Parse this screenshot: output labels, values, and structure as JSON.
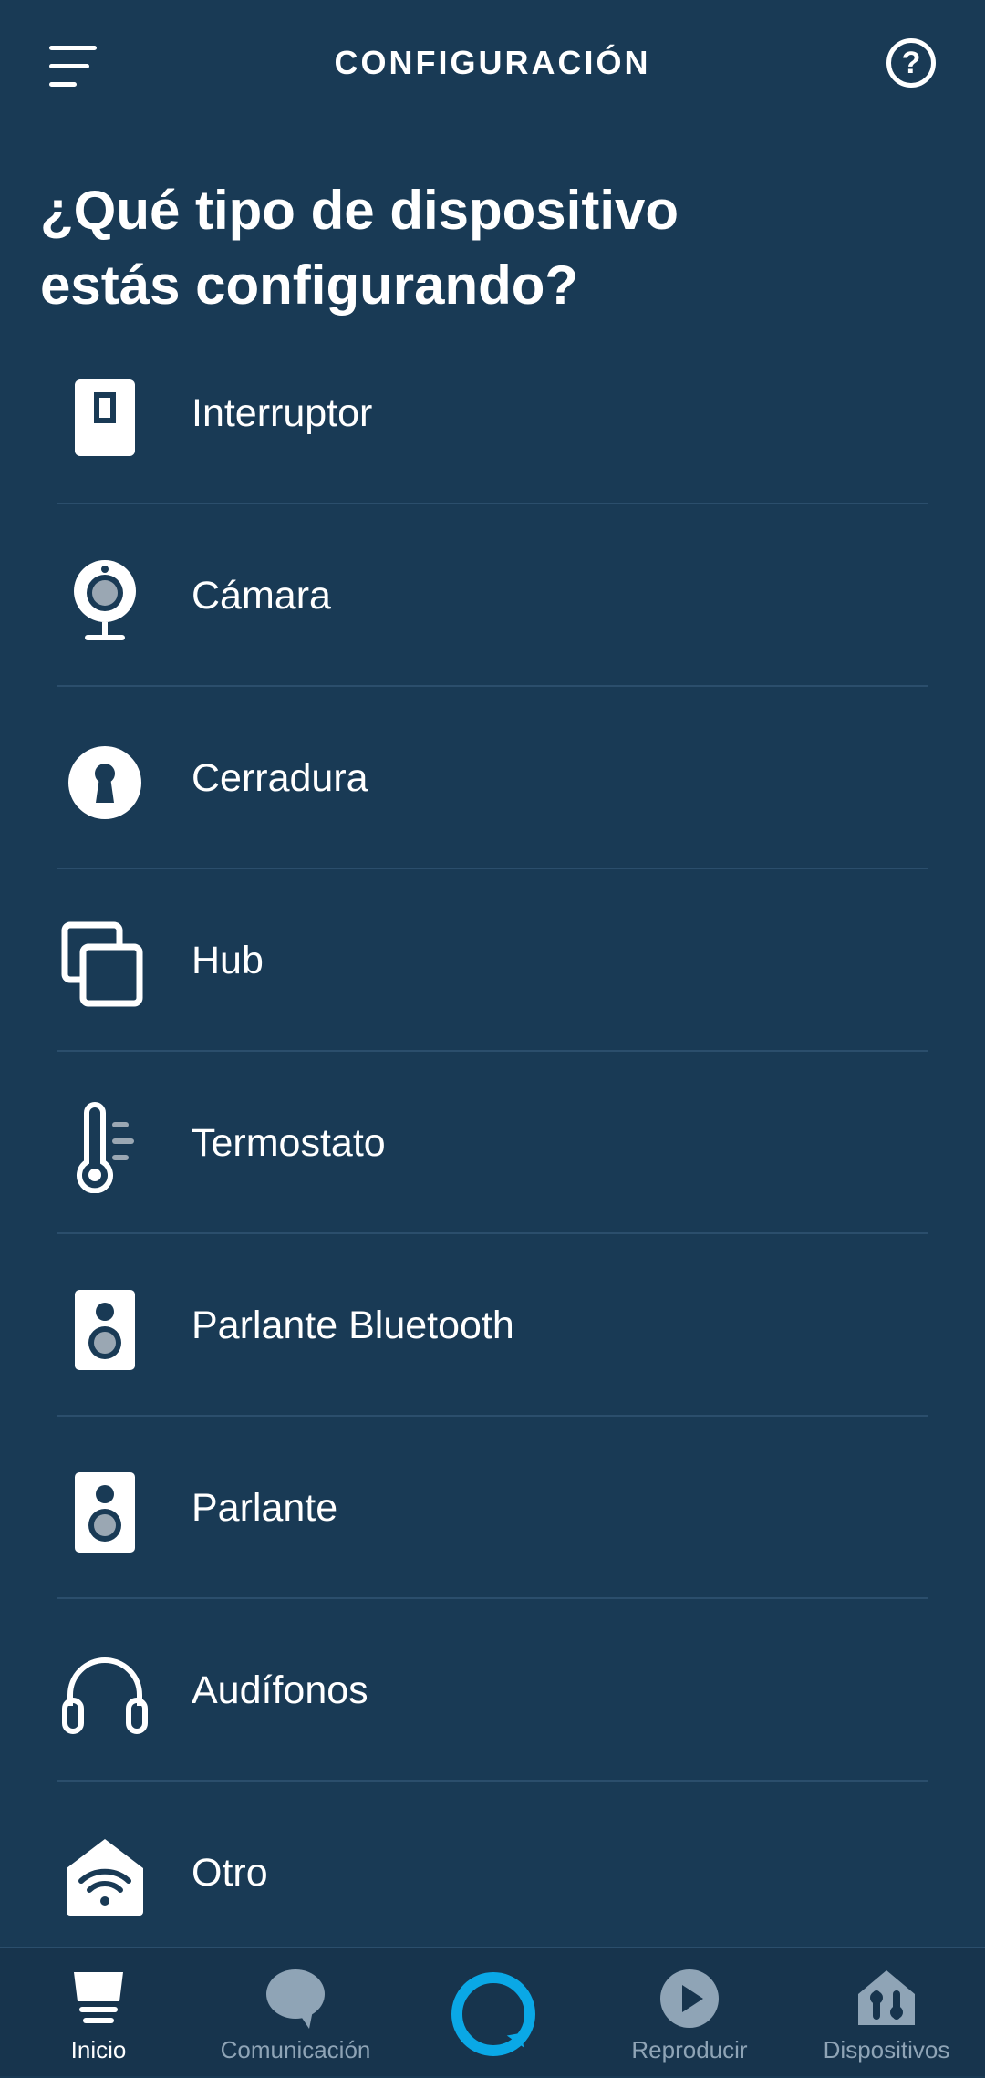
{
  "header": {
    "title": "CONFIGURACIÓN",
    "help_glyph": "?",
    "icons": {
      "menu": "hamburger-menu-icon",
      "help": "question-circle-icon"
    }
  },
  "headline": {
    "line1": "¿Qué tipo de dispositivo",
    "line2": "estás configurando?"
  },
  "device_types": [
    {
      "label": "Interruptor",
      "icon": "switch-icon"
    },
    {
      "label": "Cámara",
      "icon": "camera-icon"
    },
    {
      "label": "Cerradura",
      "icon": "lock-icon"
    },
    {
      "label": "Hub",
      "icon": "hub-icon"
    },
    {
      "label": "Termostato",
      "icon": "thermostat-icon"
    },
    {
      "label": "Parlante Bluetooth",
      "icon": "speaker-icon"
    },
    {
      "label": "Parlante",
      "icon": "speaker-icon"
    },
    {
      "label": "Audífonos",
      "icon": "headphones-icon"
    },
    {
      "label": "Otro",
      "icon": "home-wifi-icon"
    }
  ],
  "bottom_nav": {
    "items": [
      {
        "label": "Inicio",
        "icon": "home-icon",
        "active": true
      },
      {
        "label": "Comunicación",
        "icon": "chat-bubble-icon",
        "active": false
      },
      {
        "label": "",
        "icon": "alexa-ring-icon",
        "active": false
      },
      {
        "label": "Reproducir",
        "icon": "play-icon",
        "active": false
      },
      {
        "label": "Dispositivos",
        "icon": "devices-house-icon",
        "active": false
      }
    ]
  },
  "colors": {
    "background": "#193a55",
    "divider": "#2b4e6c",
    "alexa_accent": "#0aa8e6",
    "inactive_nav": "#8fa4b6",
    "text": "#ffffff"
  }
}
